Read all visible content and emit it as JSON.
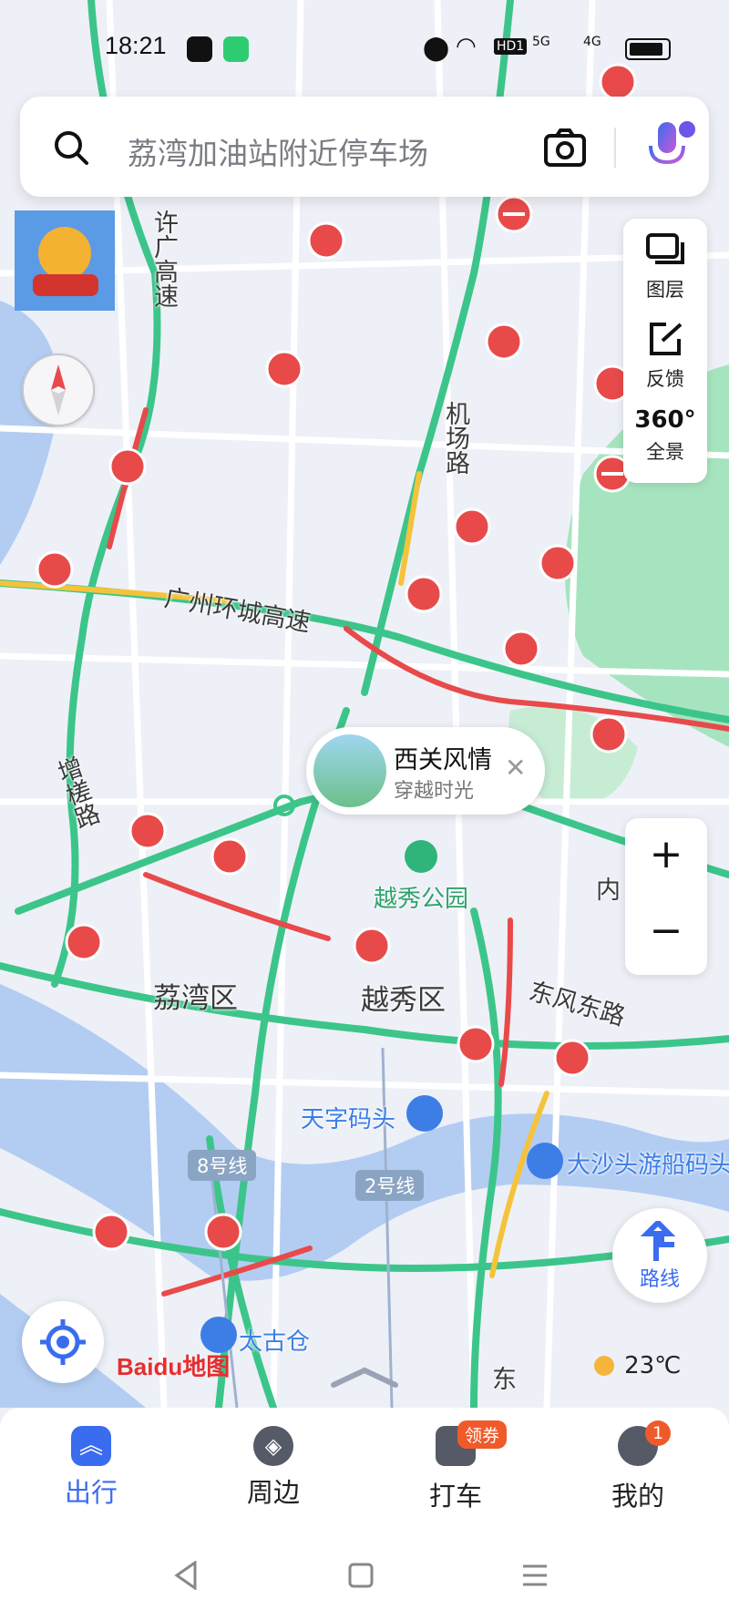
{
  "status_bar": {
    "time": "18:21",
    "signal_5g": "5G",
    "signal_4g": "4G",
    "hd_badge": "HD1"
  },
  "search": {
    "placeholder": "荔湾加油站附近停车场"
  },
  "side_tools": {
    "layers": "图层",
    "feedback": "反馈",
    "panorama": "全景",
    "panorama_icon_text": "360°"
  },
  "zoom": {
    "in": "+",
    "out": "−"
  },
  "route_button": {
    "label": "路线"
  },
  "weather": {
    "temp": "23℃"
  },
  "logo": {
    "text": "Baidu地图"
  },
  "poi_bubble": {
    "title": "西关风情",
    "subtitle": "穿越时光"
  },
  "map_labels": {
    "xuguang": "许广高速",
    "jichang": "机场路",
    "huancheng": "广州环城高速",
    "zengcha": "增槎路",
    "liwan": "荔湾区",
    "yuexiu": "越秀区",
    "dongfeng": "东风东路",
    "nei": "内",
    "yuexiu_park": "越秀公园",
    "tianzi": "天字码头",
    "dashatou": "大沙头游船码头",
    "taigucang": "太古仓",
    "dong": "东",
    "line8": "8号线",
    "line2": "2号线"
  },
  "bottom_nav": {
    "items": [
      {
        "label": "出行",
        "icon": "travel-icon"
      },
      {
        "label": "周边",
        "icon": "compass-icon"
      },
      {
        "label": "打车",
        "icon": "taxi-icon",
        "badge": "领券"
      },
      {
        "label": "我的",
        "icon": "profile-icon",
        "badge": "1"
      }
    ]
  },
  "colors": {
    "accent": "#3a6cf0",
    "road_green": "#3cc58a",
    "road_red": "#e84a4a",
    "road_yellow": "#f5c33b",
    "water": "#a9c6f0",
    "park": "#9fe0b9"
  }
}
